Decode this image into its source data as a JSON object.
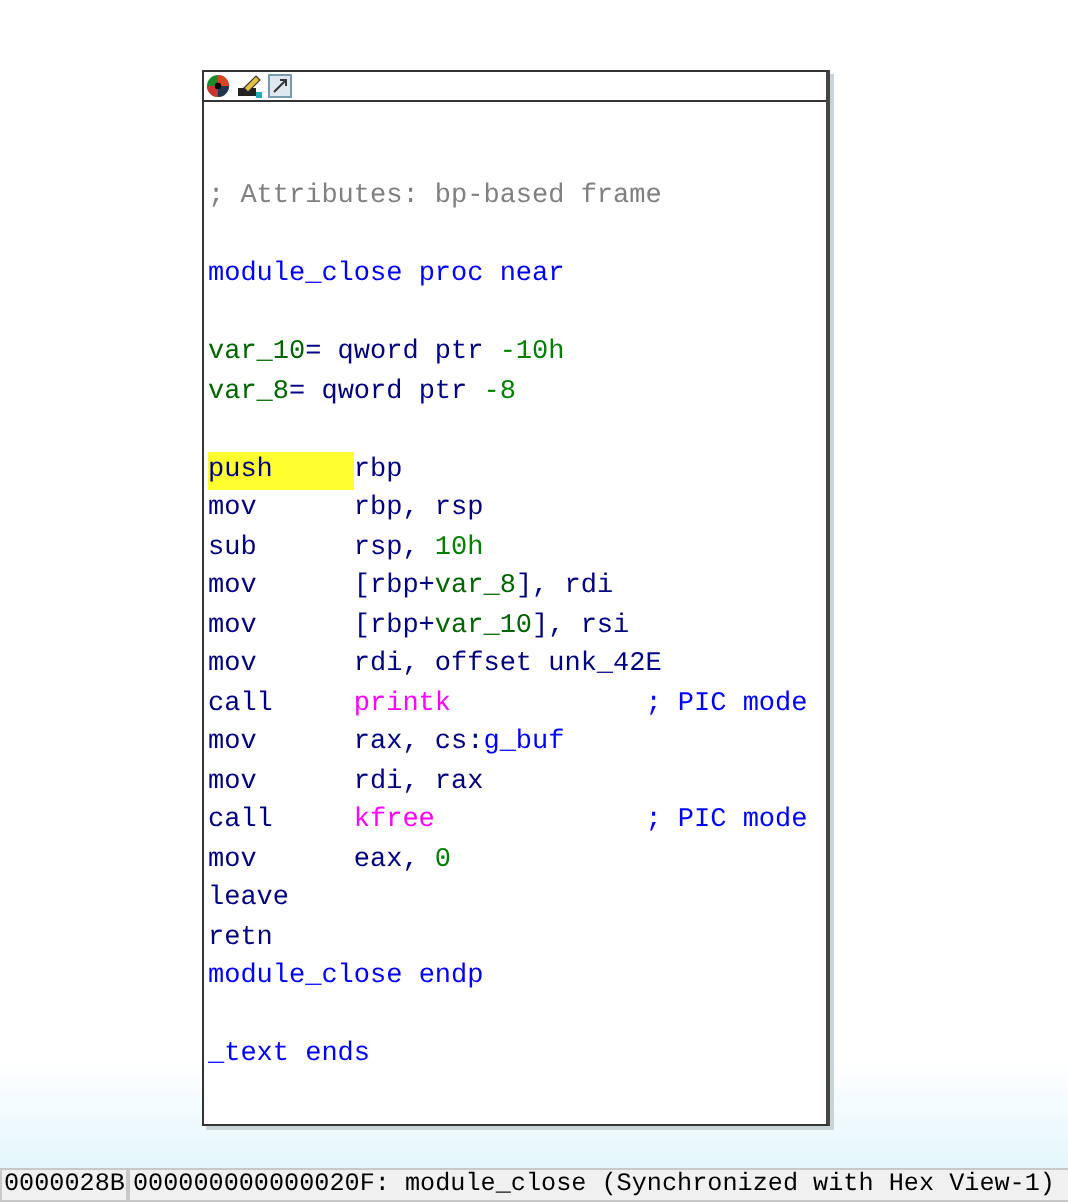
{
  "node": {
    "lines": [
      {
        "kind": "comment",
        "text": "; Attributes: bp-based frame"
      },
      {
        "kind": "blank"
      },
      {
        "kind": "label",
        "tokens": [
          {
            "text": "module_close proc near",
            "kind": "name"
          }
        ]
      },
      {
        "kind": "blank"
      },
      {
        "kind": "label",
        "tokens": [
          {
            "text": "var_10",
            "kind": "var"
          },
          {
            "text": "= qword ptr ",
            "kind": "plain"
          },
          {
            "text": "-10h",
            "kind": "num"
          }
        ]
      },
      {
        "kind": "label",
        "tokens": [
          {
            "text": "var_8",
            "kind": "var"
          },
          {
            "text": "= qword ptr ",
            "kind": "plain"
          },
          {
            "text": "-8",
            "kind": "num"
          }
        ]
      },
      {
        "kind": "blank"
      },
      {
        "kind": "insn",
        "mnemonic": "push",
        "highlighted": true,
        "operands": [
          {
            "text": "rbp",
            "kind": "plain"
          }
        ]
      },
      {
        "kind": "insn",
        "mnemonic": "mov",
        "highlighted": false,
        "operands": [
          {
            "text": "rbp, rsp",
            "kind": "plain"
          }
        ]
      },
      {
        "kind": "insn",
        "mnemonic": "sub",
        "highlighted": false,
        "operands": [
          {
            "text": "rsp, ",
            "kind": "plain"
          },
          {
            "text": "10h",
            "kind": "num"
          }
        ]
      },
      {
        "kind": "insn",
        "mnemonic": "mov",
        "highlighted": false,
        "operands": [
          {
            "text": "[rbp+",
            "kind": "plain"
          },
          {
            "text": "var_8",
            "kind": "var"
          },
          {
            "text": "], rdi",
            "kind": "plain"
          }
        ]
      },
      {
        "kind": "insn",
        "mnemonic": "mov",
        "highlighted": false,
        "operands": [
          {
            "text": "[rbp+",
            "kind": "plain"
          },
          {
            "text": "var_10",
            "kind": "var"
          },
          {
            "text": "], rsi",
            "kind": "plain"
          }
        ]
      },
      {
        "kind": "insn",
        "mnemonic": "mov",
        "highlighted": false,
        "operands": [
          {
            "text": "rdi, offset unk_42E",
            "kind": "plain"
          }
        ]
      },
      {
        "kind": "insn",
        "mnemonic": "call",
        "highlighted": false,
        "operands": [
          {
            "text": "printk",
            "kind": "import"
          }
        ],
        "comment": "; PIC mode"
      },
      {
        "kind": "insn",
        "mnemonic": "mov",
        "highlighted": false,
        "operands": [
          {
            "text": "rax, cs:",
            "kind": "plain"
          },
          {
            "text": "g_buf",
            "kind": "name"
          }
        ]
      },
      {
        "kind": "insn",
        "mnemonic": "mov",
        "highlighted": false,
        "operands": [
          {
            "text": "rdi, rax",
            "kind": "plain"
          }
        ]
      },
      {
        "kind": "insn",
        "mnemonic": "call",
        "highlighted": false,
        "operands": [
          {
            "text": "kfree",
            "kind": "import"
          }
        ],
        "comment": "; PIC mode"
      },
      {
        "kind": "insn",
        "mnemonic": "mov",
        "highlighted": false,
        "operands": [
          {
            "text": "eax, ",
            "kind": "plain"
          },
          {
            "text": "0",
            "kind": "num"
          }
        ]
      },
      {
        "kind": "insn",
        "mnemonic": "leave",
        "highlighted": false
      },
      {
        "kind": "insn",
        "mnemonic": "retn",
        "highlighted": false
      },
      {
        "kind": "label",
        "tokens": [
          {
            "text": "module_close endp",
            "kind": "name"
          }
        ]
      },
      {
        "kind": "blank"
      },
      {
        "kind": "label",
        "tokens": [
          {
            "text": "_text ends",
            "kind": "name"
          }
        ]
      }
    ]
  },
  "status_bar": {
    "offset": "0000028B",
    "location": "000000000000020F: module_close (Synchronized with Hex View-1)"
  }
}
